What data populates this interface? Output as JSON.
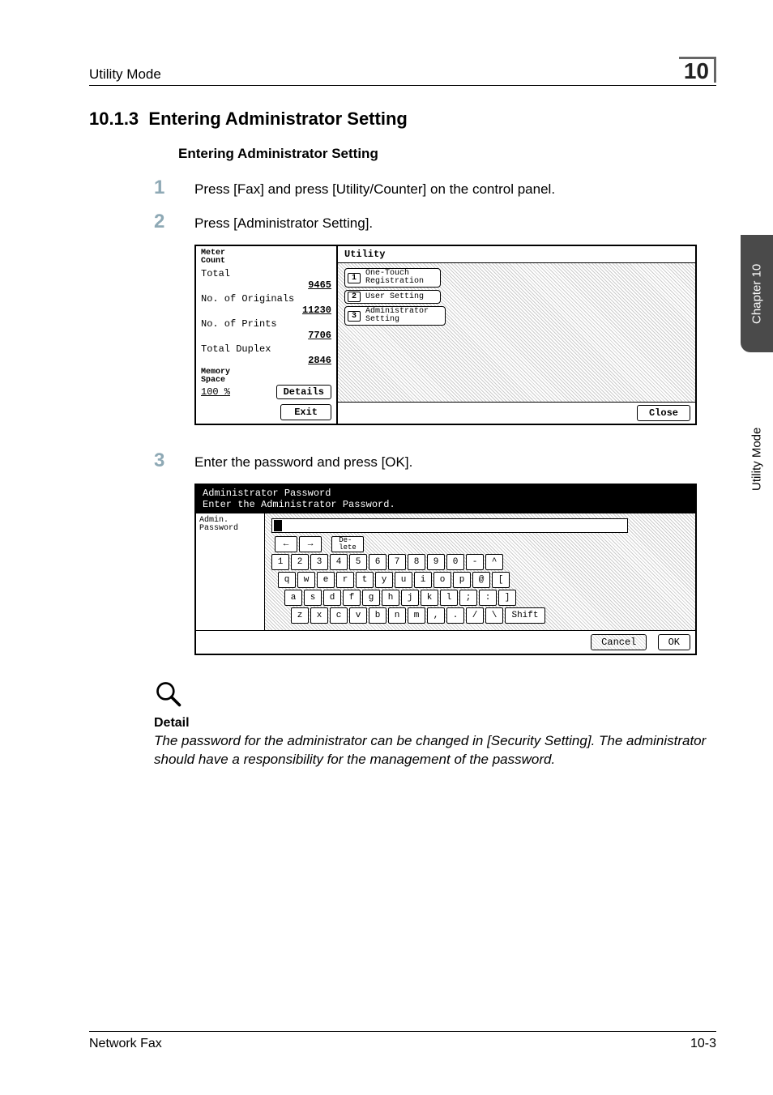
{
  "header": {
    "title": "Utility Mode",
    "chapter_num": "10"
  },
  "heading": {
    "num": "10.1.3",
    "title": "Entering Administrator Setting"
  },
  "subheading": "Entering Administrator Setting",
  "steps": {
    "s1": {
      "num": "1",
      "text": "Press [Fax] and press [Utility/Counter] on the control panel."
    },
    "s2": {
      "num": "2",
      "text": "Press [Administrator Setting]."
    },
    "s3": {
      "num": "3",
      "text": "Enter the password and press [OK]."
    }
  },
  "utility_shot": {
    "meter_label": "Meter\nCount",
    "total_label": "Total",
    "total_value": "9465",
    "originals_label": "No. of Originals",
    "originals_value": "11230",
    "prints_label": "No. of Prints",
    "prints_value": "7706",
    "duplex_label": "Total Duplex",
    "duplex_value": "2846",
    "memory_label": "Memory\nSpace",
    "memory_value": "100 %",
    "details_btn": "Details",
    "exit_btn": "Exit",
    "title": "Utility",
    "items": [
      {
        "num": "1",
        "label": "One-Touch\nRegistration"
      },
      {
        "num": "2",
        "label": "User Setting"
      },
      {
        "num": "3",
        "label": "Administrator\nSetting"
      }
    ],
    "close_btn": "Close"
  },
  "pw_shot": {
    "title": "Administrator Password",
    "prompt": "Enter the Administrator Password.",
    "left_label": "Admin.\nPassword",
    "delete_btn": "De-\nlete",
    "shift_btn": "Shift",
    "rows": {
      "r1": [
        "1",
        "2",
        "3",
        "4",
        "5",
        "6",
        "7",
        "8",
        "9",
        "0",
        "-",
        "^"
      ],
      "r2": [
        "q",
        "w",
        "e",
        "r",
        "t",
        "y",
        "u",
        "i",
        "o",
        "p",
        "@",
        "["
      ],
      "r3": [
        "a",
        "s",
        "d",
        "f",
        "g",
        "h",
        "j",
        "k",
        "l",
        ";",
        ":",
        "]"
      ],
      "r4": [
        "z",
        "x",
        "c",
        "v",
        "b",
        "n",
        "m",
        ",",
        ".",
        "/",
        "\\"
      ]
    },
    "cancel": "Cancel",
    "ok": "OK"
  },
  "detail": {
    "heading": "Detail",
    "text": "The password for the administrator can be changed in [Security Setting]. The administrator should have a responsibility for the management of the password."
  },
  "sidetab": {
    "dark": "Chapter 10",
    "light": "Utility Mode"
  },
  "footer": {
    "left": "Network Fax",
    "right": "10-3"
  }
}
